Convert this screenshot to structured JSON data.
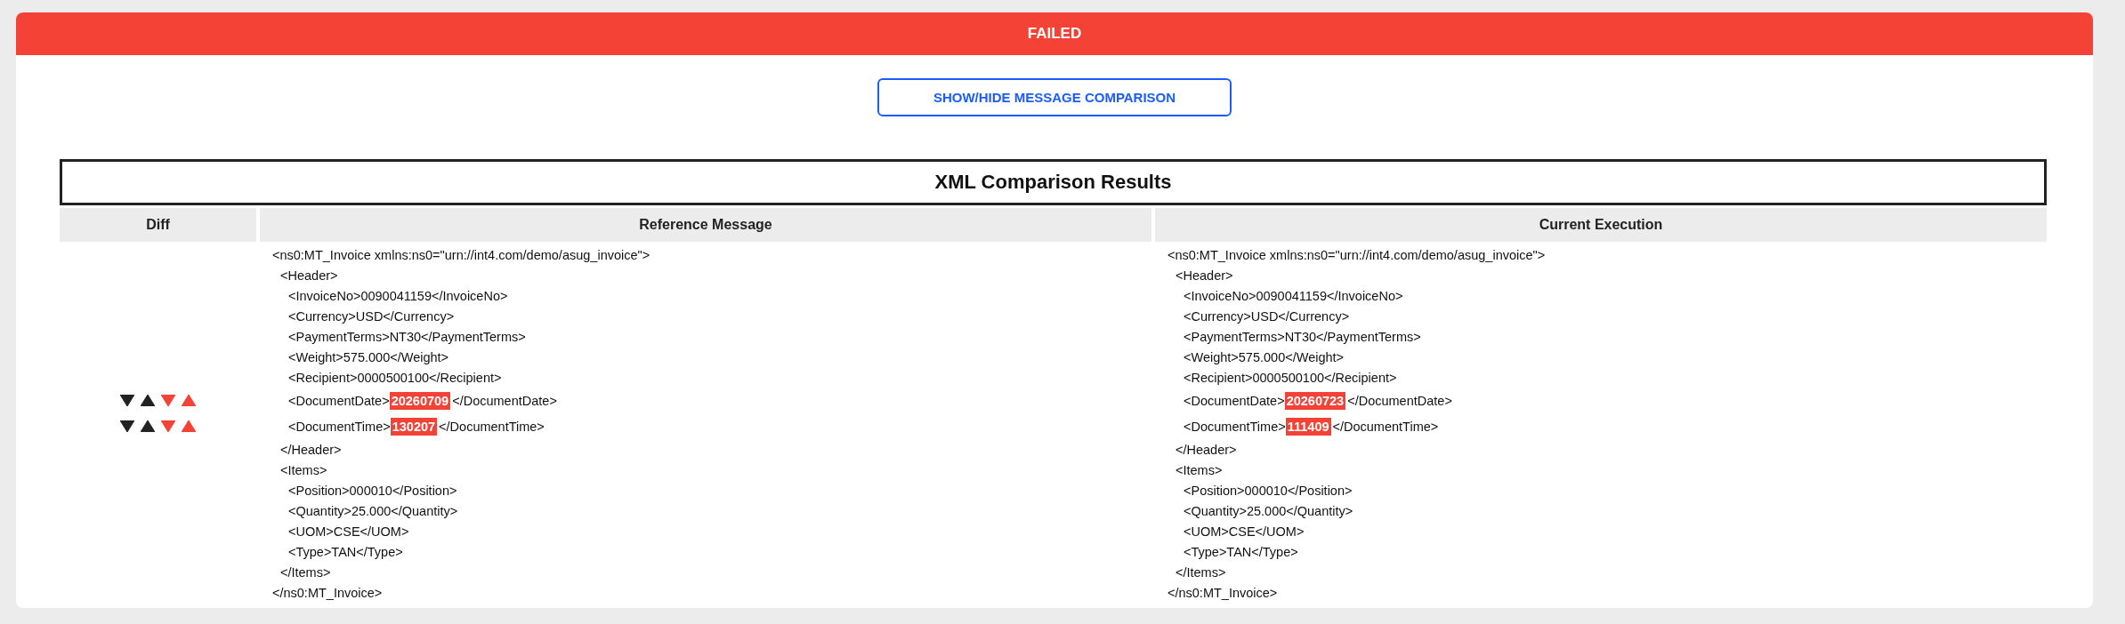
{
  "status_banner": {
    "text": "FAILED"
  },
  "toggle_button": {
    "label": "SHOW/HIDE MESSAGE COMPARISON"
  },
  "comparison": {
    "title": "XML Comparison Results",
    "columns": [
      "Diff",
      "Reference Message",
      "Current Execution"
    ],
    "reference": {
      "open": "<ns0:MT_Invoice xmlns:ns0=\"urn://int4.com/demo/asug_invoice\">",
      "close": "</ns0:MT_Invoice>",
      "children": [
        {
          "open": "<Header>",
          "close": "</Header>",
          "children": [
            {
              "kind": "text",
              "text": "<InvoiceNo>0090041159</InvoiceNo>"
            },
            {
              "kind": "text",
              "text": "<Currency>USD</Currency>"
            },
            {
              "kind": "text",
              "text": "<PaymentTerms>NT30</PaymentTerms>"
            },
            {
              "kind": "text",
              "text": "<Weight>575.000</Weight>"
            },
            {
              "kind": "text",
              "text": "<Recipient>0000500100</Recipient>"
            },
            {
              "kind": "diff",
              "before": "<DocumentDate>",
              "value": "20260709",
              "after": "</DocumentDate>"
            },
            {
              "kind": "diff",
              "before": "<DocumentTime>",
              "value": "130207",
              "after": "</DocumentTime>"
            }
          ]
        },
        {
          "open": "<Items>",
          "close": "</Items>",
          "children": [
            {
              "kind": "text",
              "text": "<Position>000010</Position>"
            },
            {
              "kind": "text",
              "text": "<Quantity>25.000</Quantity>"
            },
            {
              "kind": "text",
              "text": "<UOM>CSE</UOM>"
            },
            {
              "kind": "text",
              "text": "<Type>TAN</Type>"
            }
          ]
        }
      ]
    },
    "current": {
      "open": "<ns0:MT_Invoice xmlns:ns0=\"urn://int4.com/demo/asug_invoice\">",
      "close": "</ns0:MT_Invoice>",
      "children": [
        {
          "open": "<Header>",
          "close": "</Header>",
          "children": [
            {
              "kind": "text",
              "text": "<InvoiceNo>0090041159</InvoiceNo>"
            },
            {
              "kind": "text",
              "text": "<Currency>USD</Currency>"
            },
            {
              "kind": "text",
              "text": "<PaymentTerms>NT30</PaymentTerms>"
            },
            {
              "kind": "text",
              "text": "<Weight>575.000</Weight>"
            },
            {
              "kind": "text",
              "text": "<Recipient>0000500100</Recipient>"
            },
            {
              "kind": "diff",
              "before": "<DocumentDate>",
              "value": "20260723",
              "after": "</DocumentDate>"
            },
            {
              "kind": "diff",
              "before": "<DocumentTime>",
              "value": "111409",
              "after": "</DocumentTime>"
            }
          ]
        },
        {
          "open": "<Items>",
          "close": "</Items>",
          "children": [
            {
              "kind": "text",
              "text": "<Position>000010</Position>"
            },
            {
              "kind": "text",
              "text": "<Quantity>25.000</Quantity>"
            },
            {
              "kind": "text",
              "text": "<UOM>CSE</UOM>"
            },
            {
              "kind": "text",
              "text": "<Type>TAN</Type>"
            }
          ]
        }
      ]
    }
  }
}
